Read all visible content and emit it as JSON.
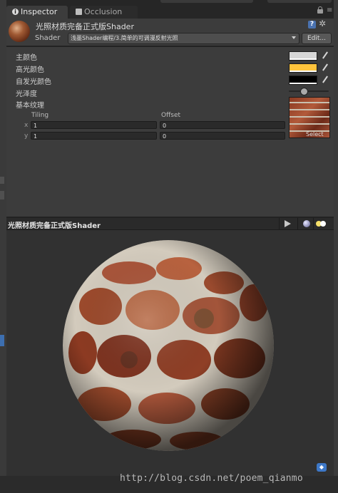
{
  "tabs": [
    {
      "label": "Inspector",
      "icon": "info-icon",
      "active": true
    },
    {
      "label": "Occlusion",
      "icon": "occlusion-icon",
      "active": false
    }
  ],
  "material": {
    "title": "光照材质完备正式版Shader",
    "shader_label": "Shader",
    "shader_value": "浅墨Shader编程/3.简单的可调漫反射光照",
    "edit_label": "Edit..."
  },
  "properties": [
    {
      "label": "主颜色",
      "type": "color",
      "color": "#d6d6d6"
    },
    {
      "label": "高光颜色",
      "type": "color",
      "color": "#ffc43c"
    },
    {
      "label": "自发光颜色",
      "type": "color",
      "color": "#000000"
    },
    {
      "label": "光泽度",
      "type": "slider",
      "value_fraction": 0.38
    },
    {
      "label": "基本纹理",
      "type": "texture",
      "select_label": "Select"
    }
  ],
  "texture": {
    "tiling_label": "Tiling",
    "offset_label": "Offset",
    "x_label": "x",
    "y_label": "y",
    "tiling_x": "1",
    "tiling_y": "1",
    "offset_x": "0",
    "offset_y": "0"
  },
  "preview": {
    "title": "光照材质完备正式版Shader"
  },
  "watermark": "http://blog.csdn.net/poem_qianmo",
  "colors": {
    "panel": "#3c3c3c",
    "preview_bg": "#313131",
    "accent_blue": "#3d78c8"
  }
}
